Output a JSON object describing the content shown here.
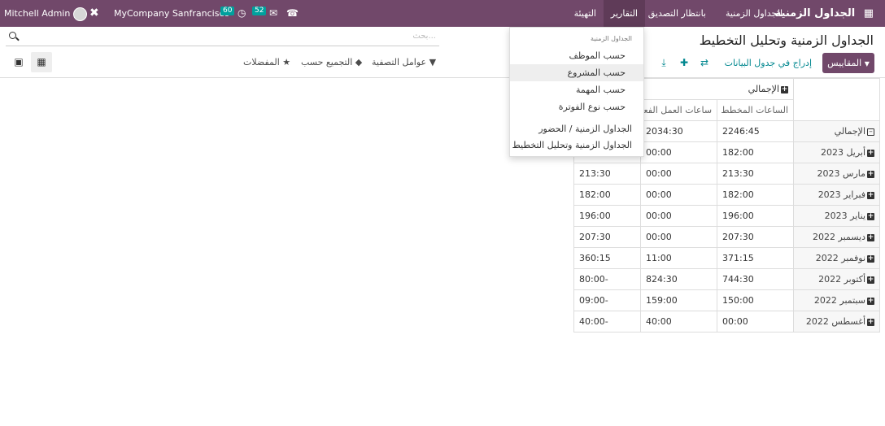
{
  "navbar": {
    "app_name": "الجداول الزمنية",
    "menus": [
      "الجداول الزمنية",
      "بانتظار التصديق",
      "التقارير",
      "التهيئة"
    ],
    "company": "MyCompany Sanfrancisco",
    "user": "Mitchell Admin",
    "activity_count": "60",
    "message_count": "52",
    "icons": [
      "apps-grid-icon",
      "debug-tools-icon",
      "activity-clock-icon",
      "chat-icon",
      "phone-icon",
      "avatar"
    ]
  },
  "control_panel": {
    "breadcrumb_title": "الجداول الزمنية وتحليل التخطيط",
    "measures_label": "المقاييس",
    "insert_label": "إدراج في جدول البيانات",
    "search_placeholder": "بحث...",
    "filters_label": "عوامل التصفية",
    "group_by_label": "التجميع حسب",
    "favorites_label": "المفضلات"
  },
  "reports_dropdown": {
    "section_header": "الجداول الزمنية",
    "items": [
      "حسب الموظف",
      "حسب المشروع",
      "حسب المهمة",
      "حسب نوع الفوترة"
    ],
    "extra_items": [
      "الجداول الزمنية / الحضور",
      "الجداول الزمنية وتحليل التخطيط"
    ]
  },
  "pivot": {
    "total_header": "الإجمالي",
    "measures": [
      "الساعات المخطط لها",
      "ساعات العمل الفعلية",
      ""
    ],
    "total_row": {
      "label": "الإجمالي",
      "values": [
        "2246:45",
        "2034:30",
        ""
      ]
    },
    "rows": [
      {
        "label": "أبريل 2023",
        "values": [
          "182:00",
          "00:00",
          ""
        ]
      },
      {
        "label": "مارس 2023",
        "values": [
          "213:30",
          "00:00",
          "213:30"
        ]
      },
      {
        "label": "فبراير 2023",
        "values": [
          "182:00",
          "00:00",
          "182:00"
        ]
      },
      {
        "label": "يناير 2023",
        "values": [
          "196:00",
          "00:00",
          "196:00"
        ]
      },
      {
        "label": "ديسمبر 2022",
        "values": [
          "207:30",
          "00:00",
          "207:30"
        ]
      },
      {
        "label": "نوفمبر 2022",
        "values": [
          "371:15",
          "11:00",
          "360:15"
        ]
      },
      {
        "label": "أكتوبر 2022",
        "values": [
          "744:30",
          "824:30",
          "80:00-"
        ]
      },
      {
        "label": "سبتمبر 2022",
        "values": [
          "150:00",
          "159:00",
          "09:00-"
        ]
      },
      {
        "label": "أغسطس 2022",
        "values": [
          "00:00",
          "40:00",
          "40:00-"
        ]
      }
    ]
  },
  "colors": {
    "navbar": "#71486a",
    "accent_link": "#00878f",
    "badge": "#00a09d"
  }
}
